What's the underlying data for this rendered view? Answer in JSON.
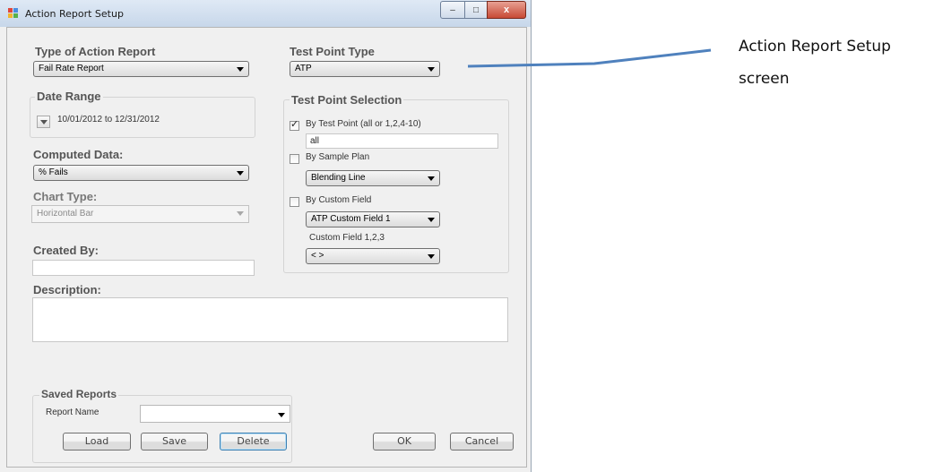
{
  "window": {
    "title": "Action Report Setup",
    "minimize": "–",
    "maximize": "□",
    "close": "x"
  },
  "report_type": {
    "label": "Type of Action Report",
    "value": "Fail Rate Report"
  },
  "date_range": {
    "label": "Date Range",
    "value": "10/01/2012 to 12/31/2012"
  },
  "computed_data": {
    "label": "Computed Data:",
    "value": "% Fails"
  },
  "chart_type": {
    "label": "Chart Type:",
    "value": "Horizontal Bar"
  },
  "created_by": {
    "label": "Created By:",
    "value": ""
  },
  "description": {
    "label": "Description:",
    "value": ""
  },
  "test_point_type": {
    "label": "Test Point Type",
    "value": "ATP"
  },
  "test_point_selection": {
    "label": "Test Point Selection",
    "by_test_point": {
      "label": "By Test Point (all or 1,2,4-10)",
      "checked": true,
      "value": "all"
    },
    "by_sample_plan": {
      "label": "By Sample Plan",
      "checked": false,
      "value": "Blending Line"
    },
    "by_custom_field": {
      "label": "By Custom Field",
      "checked": false,
      "value": "ATP Custom Field 1"
    },
    "custom_field_label": "Custom Field 1,2,3",
    "custom_field_value": "< >"
  },
  "saved_reports": {
    "label": "Saved Reports",
    "report_name_label": "Report Name",
    "report_name_value": "",
    "load": "Load",
    "save": "Save",
    "delete": "Delete"
  },
  "buttons": {
    "ok": "OK",
    "cancel": "Cancel"
  },
  "callout": {
    "line1": "Action Report Setup",
    "line2": "screen",
    "line_color": "#4f81bd"
  },
  "colors": {
    "section_label": "#555555",
    "close_button": "#c74a35",
    "titlebar": "#c7d7ea"
  }
}
